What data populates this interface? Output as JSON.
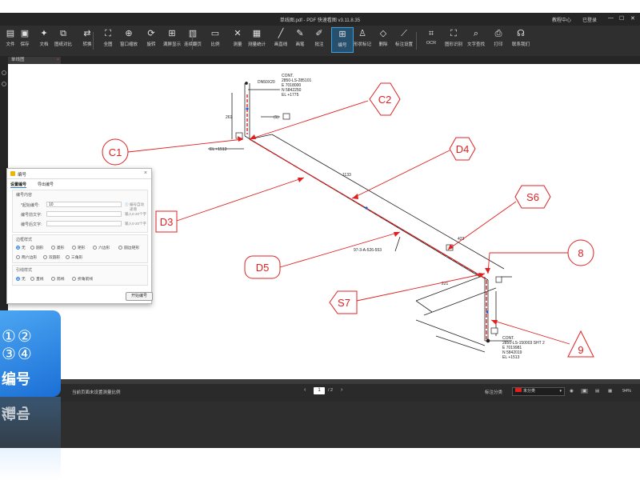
{
  "app": {
    "title": "单线图.pdf - PDF 快速看图 v3.11.8.35",
    "help_center": "教程中心",
    "login": "已登录",
    "window_controls": [
      "—",
      "☐",
      "✕"
    ]
  },
  "toolbar": {
    "items": [
      {
        "label": "文件",
        "icon": "file-icon"
      },
      {
        "label": "保存",
        "icon": "save-icon"
      },
      {
        "label": "文档",
        "icon": "document-icon"
      },
      {
        "label": "图纸对比",
        "icon": "compare-icon"
      },
      {
        "label": "转换",
        "icon": "convert-icon"
      },
      {
        "label": "全图",
        "icon": "fit-icon"
      },
      {
        "label": "窗口缩放",
        "icon": "zoom-icon"
      },
      {
        "label": "旋转",
        "icon": "rotate-icon"
      },
      {
        "label": "满屏显示",
        "icon": "fullscreen-icon"
      },
      {
        "label": "连续翻页",
        "icon": "pages-icon"
      },
      {
        "label": "比例",
        "icon": "ruler-icon"
      },
      {
        "label": "测量",
        "icon": "measure-icon"
      },
      {
        "label": "测量统计",
        "icon": "stats-icon"
      },
      {
        "label": "画直线",
        "icon": "line-icon"
      },
      {
        "label": "画笔",
        "icon": "pen-icon"
      },
      {
        "label": "批注",
        "icon": "annotate-icon"
      },
      {
        "label": "文字",
        "icon": "text-icon"
      },
      {
        "label": "编号",
        "icon": "numbering-icon"
      },
      {
        "label": "形状标记",
        "icon": "shape-icon"
      },
      {
        "label": "删除",
        "icon": "eraser-icon"
      },
      {
        "label": "标注设置",
        "icon": "markup-settings-icon"
      },
      {
        "label": "OCR",
        "icon": "ocr-icon"
      },
      {
        "label": "图形识别",
        "icon": "recognize-icon"
      },
      {
        "label": "文字查找",
        "icon": "search-icon"
      },
      {
        "label": "打印",
        "icon": "print-icon"
      },
      {
        "label": "联系我们",
        "icon": "headset-icon"
      }
    ],
    "active": "编号"
  },
  "tab": {
    "label": "单线图",
    "close": "×"
  },
  "dialog": {
    "title": "编号",
    "tabs": [
      "设置编号",
      "导出编号"
    ],
    "section_number_content": "编号内容",
    "start_label": "*起始编号:",
    "start_value": "10",
    "start_hint": "编号自动递增",
    "prefix_label": "编号前文字:",
    "prefix_hint": "输入0-20个字",
    "suffix_label": "编号后文字:",
    "suffix_hint": "输入0-20个字",
    "section_border": "边框样式",
    "border_options": [
      "无",
      "圆形",
      "菱形",
      "矩形",
      "六边形",
      "圆边矩形",
      "两六边形",
      "双圆形",
      "三角形"
    ],
    "border_selected": "无",
    "section_leader": "引线样式",
    "leader_options": [
      "无",
      "直线",
      "箭线",
      "折角箭线"
    ],
    "leader_selected": "无",
    "start_button": "开始编号",
    "close": "×"
  },
  "drawing": {
    "labels": [
      "C1",
      "C2",
      "D3",
      "D4",
      "D5",
      "S6",
      "S7",
      "8",
      "9"
    ],
    "top_text": [
      "CONT.",
      "2850-LS-285101",
      "E 7018000",
      "N 5842250",
      "EL +1775"
    ],
    "dn_text": "DN50X20",
    "el_left": "EL +1513",
    "marker_1": "(1)",
    "bottom_text": [
      "CONT.",
      "2850-LS-150003 SHT 2",
      "E 7019981",
      "N 5842019",
      "EL +1513"
    ],
    "dim_1133": "1133",
    "dim_423": "423",
    "dim_221": "221",
    "dim_261": "261",
    "spec_text": "97-3-A-526-553"
  },
  "statusbar": {
    "left_text": "当前页面未设置测量比例",
    "page_current": "1",
    "page_total": "/ 2",
    "markup_class": "标注分类",
    "class_value": "未分类",
    "zoom": "94%"
  },
  "badge": {
    "numbers_top": "①②",
    "numbers_bottom": "③④",
    "label": "编号"
  },
  "colors": {
    "accent": "#2a7fe0",
    "markup_red": "#e02020",
    "toolbar_bg": "#2f2f2f",
    "badge_blue": "#2f86ea"
  }
}
